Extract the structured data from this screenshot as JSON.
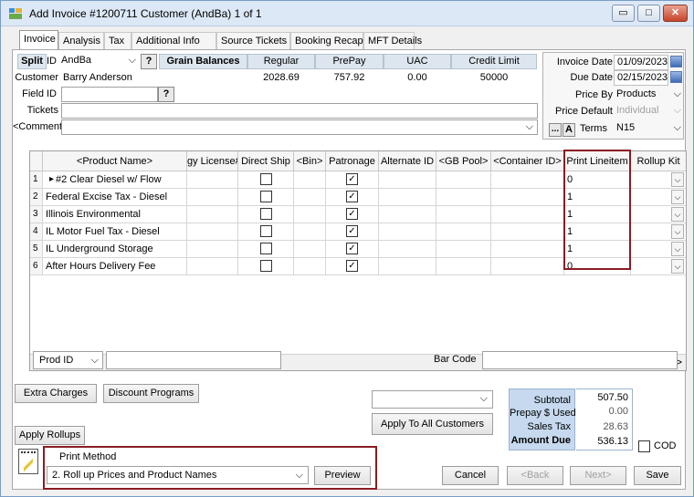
{
  "window": {
    "title": "Add Invoice #1200711 Customer (AndBa) 1 of 1"
  },
  "tabs": [
    "Invoice",
    "Analysis",
    "Tax",
    "Additional Info",
    "Source Tickets",
    "Booking Recap",
    "MFT Details"
  ],
  "header": {
    "split_label": "Split",
    "id_label": "ID",
    "id_value": "AndBa",
    "grain_balances_label": "Grain Balances",
    "customer_label": "Customer",
    "customer_value": "Barry Anderson",
    "field_id_label": "Field ID",
    "tickets_label": "Tickets",
    "comments_label": "<Comments>",
    "q": "?"
  },
  "balances": {
    "headers": [
      "Regular",
      "PrePay",
      "UAC",
      "Credit Limit"
    ],
    "values": [
      "2028.69",
      "757.92",
      "0.00",
      "50000"
    ]
  },
  "dates": {
    "invoice_date_label": "Invoice Date",
    "invoice_date": "01/09/2023",
    "due_date_label": "Due Date",
    "due_date": "02/15/2023",
    "price_by_label": "Price By",
    "price_by": "Products",
    "price_default_label": "Price Default",
    "price_default": "Individual",
    "terms_label": "Terms",
    "terms": "N15",
    "more": "...",
    "a": "A"
  },
  "grid": {
    "columns": [
      "<Product Name>",
      "gy License#",
      "Direct Ship",
      "<Bin>",
      "Patronage",
      "Alternate ID",
      "<GB Pool>",
      "<Container ID>",
      "Print Lineitem",
      "Rollup Kit"
    ],
    "rows": [
      {
        "num": "1",
        "name": "#2 Clear Diesel w/ Flow",
        "direct_ship": false,
        "patronage": true,
        "print": "0"
      },
      {
        "num": "2",
        "name": "Federal Excise Tax - Diesel",
        "direct_ship": false,
        "patronage": true,
        "print": "1"
      },
      {
        "num": "3",
        "name": "Illinois Environmental",
        "direct_ship": false,
        "patronage": true,
        "print": "1"
      },
      {
        "num": "4",
        "name": "IL Motor Fuel Tax - Diesel",
        "direct_ship": false,
        "patronage": true,
        "print": "1"
      },
      {
        "num": "5",
        "name": "IL Underground Storage",
        "direct_ship": false,
        "patronage": true,
        "print": "1"
      },
      {
        "num": "6",
        "name": "After Hours Delivery Fee",
        "direct_ship": false,
        "patronage": true,
        "print": "0"
      }
    ]
  },
  "prod": {
    "prod_id_label": "Prod ID",
    "bar_code_label": "Bar Code"
  },
  "buttons": {
    "extra_charges": "Extra Charges",
    "discount_programs": "Discount Programs",
    "apply_to_all": "Apply To All Customers",
    "apply_rollups": "Apply Rollups",
    "preview": "Preview",
    "cancel": "Cancel",
    "back": "<Back",
    "next": "Next>",
    "save": "Save"
  },
  "print_method": {
    "label": "Print Method",
    "value": "2. Roll up Prices and Product Names"
  },
  "totals": {
    "subtotal_label": "Subtotal",
    "subtotal": "507.50",
    "prepay_label": "Prepay $ Used",
    "prepay": "0.00",
    "sales_tax_label": "Sales Tax",
    "sales_tax": "28.63",
    "amount_due_label": "Amount Due",
    "amount_due": "536.13",
    "cod_label": "COD"
  },
  "colors": {
    "highlight_border": "#8b1c23",
    "totals_bg": "#c6d9ee"
  }
}
